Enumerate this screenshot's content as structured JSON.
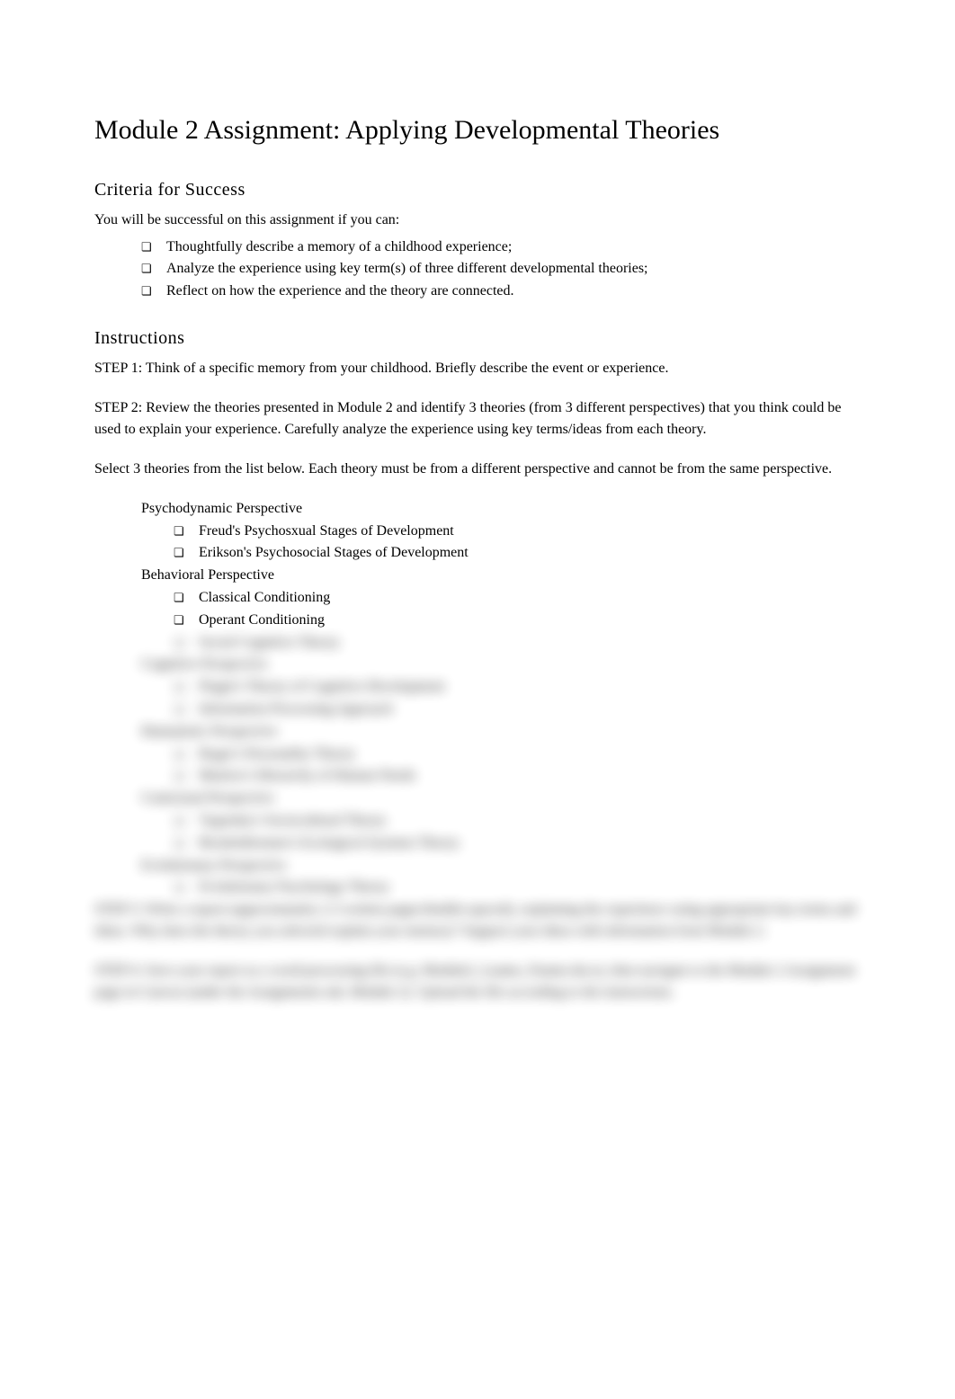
{
  "title": "Module 2 Assignment: Applying Developmental Theories",
  "criteria": {
    "heading": "Criteria for Success",
    "intro": "You will be successful on this assignment if you can:",
    "items": [
      "Thoughtfully describe a memory of a childhood experience;",
      "Analyze the experience using key term(s) of three different developmental theories;",
      "Reflect on how the experience and the theory are connected."
    ]
  },
  "instructions": {
    "heading": "Instructions",
    "step1": "STEP 1: Think of a specific memory from your childhood. Briefly describe the event or experience.",
    "step2": "STEP 2: Review the theories presented in Module 2 and identify 3 theories (from 3 different perspectives) that you think could be used to explain your experience. Carefully analyze the experience using key terms/ideas from each theory.",
    "select": "Select 3 theories from the list below. Each theory must be from a different perspective and cannot be from the same perspective."
  },
  "perspectives": [
    {
      "label": "Psychodynamic Perspective",
      "theories": [
        "Freud's Psychosxual Stages of Development",
        "Erikson's Psychosocial Stages of Development"
      ]
    },
    {
      "label": "Behavioral Perspective",
      "theories": [
        "Classical Conditioning",
        "Operant Conditioning",
        "Social Cognitive Theory"
      ]
    },
    {
      "label": "Cognitive Perspective",
      "theories": [
        "Piaget's Theory of Cognitive Development",
        "Information Processing Approach"
      ]
    },
    {
      "label": "Humanistic Perspective",
      "theories": [
        "Roger's Personality Theory",
        "Maslow's Hierarchy of Human Needs"
      ]
    },
    {
      "label": "Contextual Perspective",
      "theories": [
        "Vygotsky's Sociocultural Theory",
        "Bronfenbrenner's Ecological Systems Theory"
      ]
    },
    {
      "label": "Evolutionary Perspective",
      "theories": [
        "Evolutionary Psychology Theory"
      ]
    }
  ],
  "blurred_paras": [
    "STEP 3: Write a report (approximately 2-3 written pages/double-spaced), explaining the experience using appropriate key terms and ideas. Why does the theory you selected explain your memory? Support your ideas with information from Module 2.",
    "STEP 4: Save your report as a word-processing file (e.g. Module2_Lname_Fname.docx), then navigate to the Module 2 Assignment page in Canvas (under the Assignments tab, Module 2). Upload the file according to the instructions."
  ]
}
